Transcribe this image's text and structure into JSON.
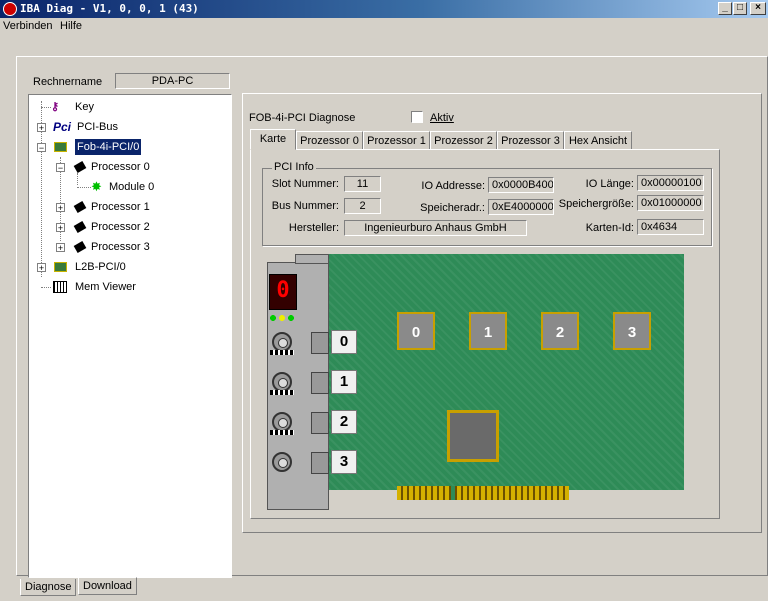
{
  "window": {
    "title": "IBA Diag - V1, 0, 0, 1 (43)",
    "min": "_",
    "max": "□",
    "close": "×"
  },
  "menu": {
    "items": [
      "Verbinden",
      "Hilfe"
    ]
  },
  "computer": {
    "label": "Rechnername",
    "value": "PDA-PC"
  },
  "tree": {
    "key": "Key",
    "pcibus": "PCI-Bus",
    "pcibus_icon": "Pci",
    "fob": "Fob-4i-PCI/0",
    "proc0": "Processor 0",
    "module0": "Module 0",
    "proc1": "Processor 1",
    "proc2": "Processor 2",
    "proc3": "Processor 3",
    "l2b": "L2B-PCI/0",
    "mem": "Mem Viewer"
  },
  "panel": {
    "title": "FOB-4i-PCI Diagnose",
    "aktiv_label": "Aktiv",
    "aktiv_checked": false,
    "tabs": [
      "Karte",
      "Prozessor 0",
      "Prozessor 1",
      "Prozessor 2",
      "Prozessor 3",
      "Hex Ansicht"
    ],
    "active_tab": "Karte"
  },
  "pci_info": {
    "group_label": "PCI Info",
    "slot_label": "Slot Nummer:",
    "slot_value": "11",
    "bus_label": "Bus Nummer:",
    "bus_value": "2",
    "io_addr_label": "IO Addresse:",
    "io_addr_value": "0x0000B400",
    "mem_addr_label": "Speicheradr.:",
    "mem_addr_value": "0xE4000000",
    "io_len_label": "IO Länge:",
    "io_len_value": "0x00000100",
    "mem_size_label": "Speichergröße:",
    "mem_size_value": "0x01000000",
    "vendor_label": "Hersteller:",
    "vendor_value": "Ingenieurburo Anhaus GmbH",
    "card_id_label": "Karten-Id:",
    "card_id_value": "0x4634"
  },
  "board": {
    "display_digit": "0",
    "processors": [
      "0",
      "1",
      "2",
      "3"
    ],
    "ports": [
      "0",
      "1",
      "2",
      "3"
    ],
    "colors": {
      "pcb": "#2e8b57",
      "chip": "#8a8a8a",
      "gold": "#c8a000"
    }
  },
  "bottom_tabs": [
    "Diagnose",
    "Download"
  ]
}
